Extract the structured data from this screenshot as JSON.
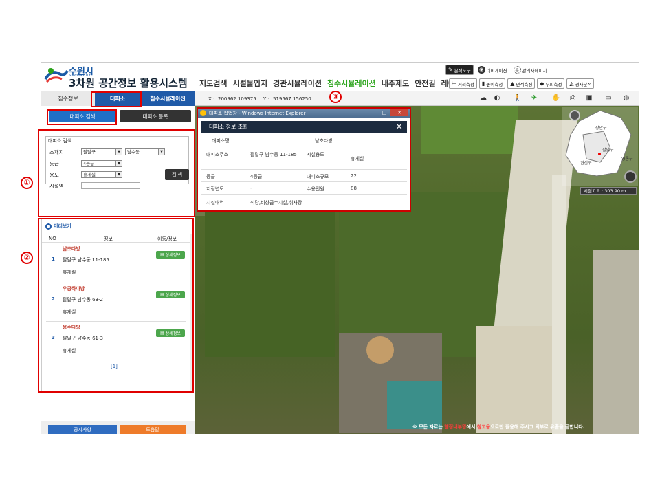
{
  "header": {
    "city_ko": "수원시",
    "city_en": "SUWON CITY",
    "title": "3차원 공간정보 활용시스템",
    "main_nav": [
      "지도검색",
      "시설물입지",
      "경관시뮬레이션",
      "침수시뮬레이션",
      "내주제도",
      "안전길",
      "레이어"
    ],
    "active_nav": "침수시뮬레이션",
    "top_tools": [
      "분석도구",
      "네비게이션",
      "관리자페이지"
    ],
    "measure_tools": [
      "거리측정",
      "높이측정",
      "면적측정",
      "부피측정",
      "경사분석"
    ]
  },
  "left_tabs": [
    "침수정보",
    "대피소",
    "침수시뮬레이션"
  ],
  "sub_buttons": [
    "대피소 검색",
    "대피소 등록"
  ],
  "search": {
    "title": "대피소 검색",
    "location_label": "소재지",
    "district": "팔달구",
    "dong": "남수동",
    "grade_label": "등급",
    "grade": "4등급",
    "use_label": "용도",
    "use": "휴게실",
    "name_label": "시설명",
    "name_value": "",
    "button": "검 색"
  },
  "preview": {
    "title": "미리보기",
    "headers": [
      "NO",
      "정보",
      "이동/정보"
    ],
    "items": [
      {
        "no": "1",
        "name": "남초다방",
        "address": "팔달구 남수동 11-185",
        "use": "휴게실",
        "button": "상세정보"
      },
      {
        "no": "2",
        "name": "우궁하다방",
        "address": "팔달구 남수동 63-2",
        "use": "휴게실",
        "button": "상세정보"
      },
      {
        "no": "3",
        "name": "용수다방",
        "address": "팔달구 남수동 61-3",
        "use": "휴게실",
        "button": "상세정보"
      }
    ],
    "pagination": "[1]"
  },
  "footer_buttons": [
    "공지사항",
    "도움말"
  ],
  "map": {
    "x_label": "X :",
    "x_value": "200962.109375",
    "y_label": "Y :",
    "y_value": "519567.156250",
    "altitude": "시점고도 : 303.90 m",
    "inset_labels": [
      "장안구",
      "팔달구",
      "영통구",
      "권선구"
    ],
    "notice_prefix": "※ 모든 자료는 ",
    "notice_hl1": "행정내부망",
    "notice_mid": "에서 ",
    "notice_hl2": "참고용",
    "notice_suffix": "으로만 활용해 주시고 외부로 유출을 금합니다."
  },
  "popup": {
    "window_title": "대피소 팝업창 - Windows Internet Explorer",
    "header": "대피소 정보 조회",
    "close": "×",
    "rows": [
      {
        "k1": "대피소명",
        "v1": "",
        "k2": "",
        "v2": "남초다방"
      },
      {
        "k1": "대피소주소",
        "v1": "팔달구 남수동 11-185",
        "k2": "시설용도",
        "v2": "휴게실"
      },
      {
        "k1": "등급",
        "v1": "4등급",
        "k2": "대피소규모",
        "v2": "22"
      },
      {
        "k1": "지정년도",
        "v1": "-",
        "k2": "수용인원",
        "v2": "88"
      },
      {
        "k1": "시설내역",
        "v1": "식당,비상급수시설,취사장",
        "k2": "",
        "v2": ""
      }
    ]
  },
  "annotations": [
    "①",
    "②",
    "③"
  ]
}
